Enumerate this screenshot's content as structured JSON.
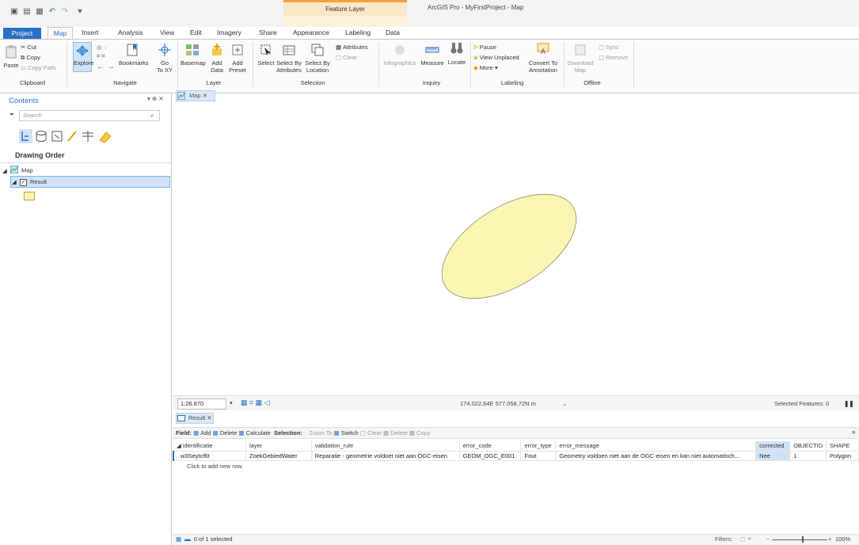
{
  "app_title": "ArcGIS Pro - MyFirstProject - Map",
  "contextual_tab": "Feature Layer",
  "tabs": [
    "Project",
    "Map",
    "Insert",
    "Analysis",
    "View",
    "Edit",
    "Imagery",
    "Share",
    "Appearance",
    "Labeling",
    "Data"
  ],
  "ribbon": {
    "clipboard": {
      "paste": "Paste",
      "cut": "Cut",
      "copy": "Copy",
      "copy_path": "Copy Path",
      "label": "Clipboard"
    },
    "navigate": {
      "explore": "Explore",
      "bookmarks": "Bookmarks",
      "goto": "Go",
      "goto2": "To XY",
      "label": "Navigate"
    },
    "layer": {
      "basemap": "Basemap",
      "add_data": "Add",
      "add_data2": "Data",
      "add_preset": "Add",
      "add_preset2": "Preset",
      "label": "Layer"
    },
    "selection": {
      "select": "Select",
      "by_attr": "Select By",
      "by_attr2": "Attributes",
      "by_loc": "Select By",
      "by_loc2": "Location",
      "attributes": "Attributes",
      "clear": "Clear",
      "label": "Selection"
    },
    "inquiry": {
      "infographics": "Infographics",
      "measure": "Measure",
      "locate": "Locate",
      "label": "Inquiry"
    },
    "labeling": {
      "pause": "Pause",
      "view_unplaced": "View Unplaced",
      "more": "More",
      "convert": "Convert To",
      "convert2": "Annotation",
      "label": "Labeling"
    },
    "offline": {
      "download": "Download",
      "download2": "Map",
      "sync": "Sync",
      "remove": "Remove",
      "label": "Offline"
    }
  },
  "contents": {
    "title": "Contents",
    "search_placeholder": "Search",
    "drawing_order": "Drawing Order",
    "map_name": "Map",
    "layer_name": "Result"
  },
  "map_view": {
    "tab_label": "Map",
    "scale": "1:26.870",
    "coordinates": "174.022,64E 577.058,72N m",
    "selected_features": "Selected Features: 0"
  },
  "table": {
    "tab_label": "Result",
    "toolbar": {
      "field": "Field:",
      "add": "Add",
      "delete": "Delete",
      "calculate": "Calculate",
      "selection": "Selection:",
      "zoom_to": "Zoom To",
      "switch": "Switch",
      "clear": "Clear",
      "delete2": "Delete",
      "copy": "Copy"
    },
    "columns": [
      "identificatie",
      "layer",
      "validation_rule",
      "error_code",
      "error_type",
      "error_message",
      "corrected",
      "OBJECTID",
      "SHAPE"
    ],
    "rows": [
      [
        "w3Seytcf6t",
        "ZoekGebiedWater",
        "Reparatie - geometrie voldoet niet aan OGC-eisen",
        "GEOM_OGC_E001",
        "Fout",
        "Geometry voldoen niet aan de OGC-eisen en kan niet automatisch...",
        "Nee",
        "1",
        "Polygon"
      ]
    ],
    "new_row": "Click to add new row.",
    "status": "0 of 1 selected",
    "filters": "Filters:",
    "zoom": "100%"
  },
  "colors": {
    "accent": "#2a6fc7",
    "feature_fill": "#fbf5b3",
    "feature_stroke": "#8a8a6a",
    "contextual": "#f0a33c"
  }
}
